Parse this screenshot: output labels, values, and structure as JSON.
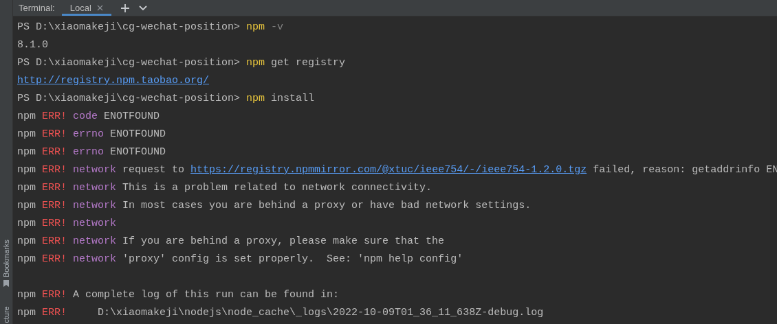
{
  "toolbar": {
    "label": "Terminal:",
    "tabs": [
      {
        "label": "Local",
        "selected": true
      }
    ]
  },
  "sidebar": {
    "items": [
      {
        "label": "Bookmarks"
      },
      {
        "label": "cture"
      }
    ]
  },
  "lines": [
    {
      "segments": [
        {
          "kind": "plain",
          "text": "PS D:\\xiaomakeji\\cg-wechat-position> "
        },
        {
          "kind": "cmd",
          "text": "npm"
        },
        {
          "kind": "flag",
          "text": " -v"
        }
      ]
    },
    {
      "segments": [
        {
          "kind": "plain",
          "text": "8.1.0"
        }
      ]
    },
    {
      "segments": [
        {
          "kind": "plain",
          "text": "PS D:\\xiaomakeji\\cg-wechat-position> "
        },
        {
          "kind": "cmd",
          "text": "npm"
        },
        {
          "kind": "plain",
          "text": " get registry"
        }
      ]
    },
    {
      "segments": [
        {
          "kind": "link",
          "text": "http://registry.npm.taobao.org/"
        }
      ]
    },
    {
      "segments": [
        {
          "kind": "plain",
          "text": "PS D:\\xiaomakeji\\cg-wechat-position> "
        },
        {
          "kind": "cmd",
          "text": "npm"
        },
        {
          "kind": "plain",
          "text": " install"
        }
      ]
    },
    {
      "segments": [
        {
          "kind": "plain",
          "text": "npm "
        },
        {
          "kind": "err",
          "text": "ERR!"
        },
        {
          "kind": "key",
          "text": " code"
        },
        {
          "kind": "plain",
          "text": " ENOTFOUND"
        }
      ]
    },
    {
      "segments": [
        {
          "kind": "plain",
          "text": "npm "
        },
        {
          "kind": "err",
          "text": "ERR!"
        },
        {
          "kind": "key",
          "text": " errno"
        },
        {
          "kind": "plain",
          "text": " ENOTFOUND"
        }
      ]
    },
    {
      "segments": [
        {
          "kind": "plain",
          "text": "npm "
        },
        {
          "kind": "err",
          "text": "ERR!"
        },
        {
          "kind": "key",
          "text": " errno"
        },
        {
          "kind": "plain",
          "text": " ENOTFOUND"
        }
      ]
    },
    {
      "segments": [
        {
          "kind": "plain",
          "text": "npm "
        },
        {
          "kind": "err",
          "text": "ERR!"
        },
        {
          "kind": "key",
          "text": " network"
        },
        {
          "kind": "plain",
          "text": " request to "
        },
        {
          "kind": "link",
          "text": "https://registry.npmmirror.com/@xtuc/ieee754/-/ieee754-1.2.0.tgz"
        },
        {
          "kind": "plain",
          "text": " failed, reason: getaddrinfo EN"
        }
      ]
    },
    {
      "segments": [
        {
          "kind": "plain",
          "text": "npm "
        },
        {
          "kind": "err",
          "text": "ERR!"
        },
        {
          "kind": "key",
          "text": " network"
        },
        {
          "kind": "plain",
          "text": " This is a problem related to network connectivity."
        }
      ]
    },
    {
      "segments": [
        {
          "kind": "plain",
          "text": "npm "
        },
        {
          "kind": "err",
          "text": "ERR!"
        },
        {
          "kind": "key",
          "text": " network"
        },
        {
          "kind": "plain",
          "text": " In most cases you are behind a proxy or have bad network settings."
        }
      ]
    },
    {
      "segments": [
        {
          "kind": "plain",
          "text": "npm "
        },
        {
          "kind": "err",
          "text": "ERR!"
        },
        {
          "kind": "key",
          "text": " network"
        }
      ]
    },
    {
      "segments": [
        {
          "kind": "plain",
          "text": "npm "
        },
        {
          "kind": "err",
          "text": "ERR!"
        },
        {
          "kind": "key",
          "text": " network"
        },
        {
          "kind": "plain",
          "text": " If you are behind a proxy, please make sure that the"
        }
      ]
    },
    {
      "segments": [
        {
          "kind": "plain",
          "text": "npm "
        },
        {
          "kind": "err",
          "text": "ERR!"
        },
        {
          "kind": "key",
          "text": " network"
        },
        {
          "kind": "plain",
          "text": " 'proxy' config is set properly.  See: 'npm help config'"
        }
      ]
    },
    {
      "blank_before": true,
      "segments": [
        {
          "kind": "plain",
          "text": "npm "
        },
        {
          "kind": "err",
          "text": "ERR!"
        },
        {
          "kind": "plain",
          "text": " A complete log of this run can be found in:"
        }
      ]
    },
    {
      "segments": [
        {
          "kind": "plain",
          "text": "npm "
        },
        {
          "kind": "err",
          "text": "ERR!"
        },
        {
          "kind": "plain",
          "text": "     D:\\xiaomakeji\\nodejs\\node_cache\\_logs\\2022-10-09T01_36_11_638Z-debug.log"
        }
      ]
    }
  ]
}
